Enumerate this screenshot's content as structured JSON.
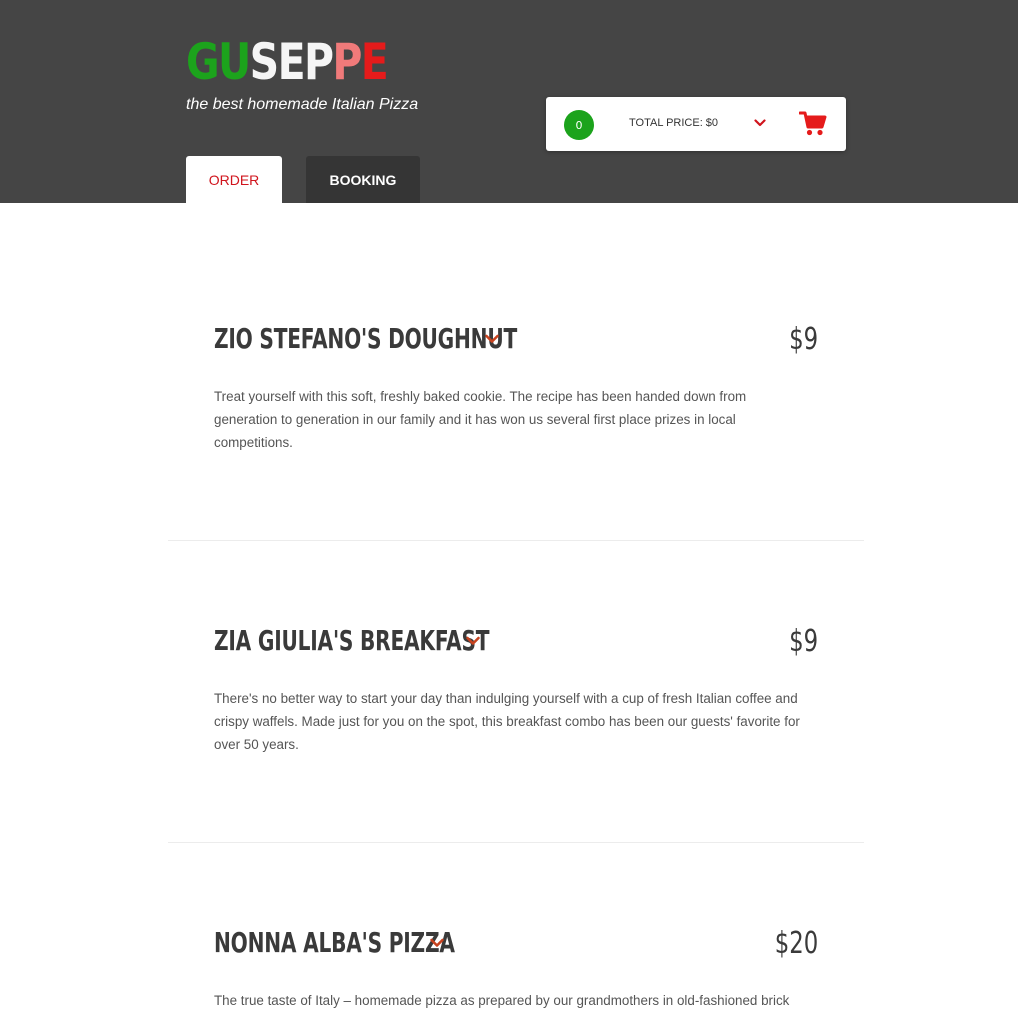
{
  "brand": {
    "letters": [
      {
        "char": "G",
        "color": "#1ca31c"
      },
      {
        "char": "U",
        "color": "#1ca31c"
      },
      {
        "char": "S",
        "color": "#f5f5f5"
      },
      {
        "char": "E",
        "color": "#f5f5f5"
      },
      {
        "char": "P",
        "color": "#f5f5f5"
      },
      {
        "char": "P",
        "color": "#f07a7a"
      },
      {
        "char": "E",
        "color": "#e51b1b"
      }
    ],
    "tagline": "the best homemade Italian Pizza"
  },
  "tabs": {
    "order": "ORDER",
    "booking": "BOOKING",
    "active": "order"
  },
  "cart": {
    "count": "0",
    "total_label": "TOTAL PRICE: $0",
    "chevron_icon": "chevron-down-icon",
    "cart_icon": "shopping-cart-icon"
  },
  "colors": {
    "header_bg": "#454545",
    "accent_red": "#d0141d",
    "chevron": "#c8431f",
    "badge_green": "#1ca31c"
  },
  "menu": {
    "items": [
      {
        "title": "ZIO STEFANO'S DOUGHNUT",
        "price": "$9",
        "description": "Treat yourself with this soft, freshly baked cookie. The recipe has been handed down from generation to generation in our family and it has won us several first place prizes in local competitions."
      },
      {
        "title": "ZIA GIULIA'S BREAKFAST",
        "price": "$9",
        "description": "There's no better way to start your day than indulging yourself with a cup of fresh Italian coffee and crispy waffels. Made just for you on the spot, this breakfast combo has been our guests' favorite for over 50 years."
      },
      {
        "title": "NONNA ALBA'S PIZZA",
        "price": "$20",
        "description": "The true taste of Italy – homemade pizza as prepared by our grandmothers in old-fashioned brick"
      }
    ]
  }
}
